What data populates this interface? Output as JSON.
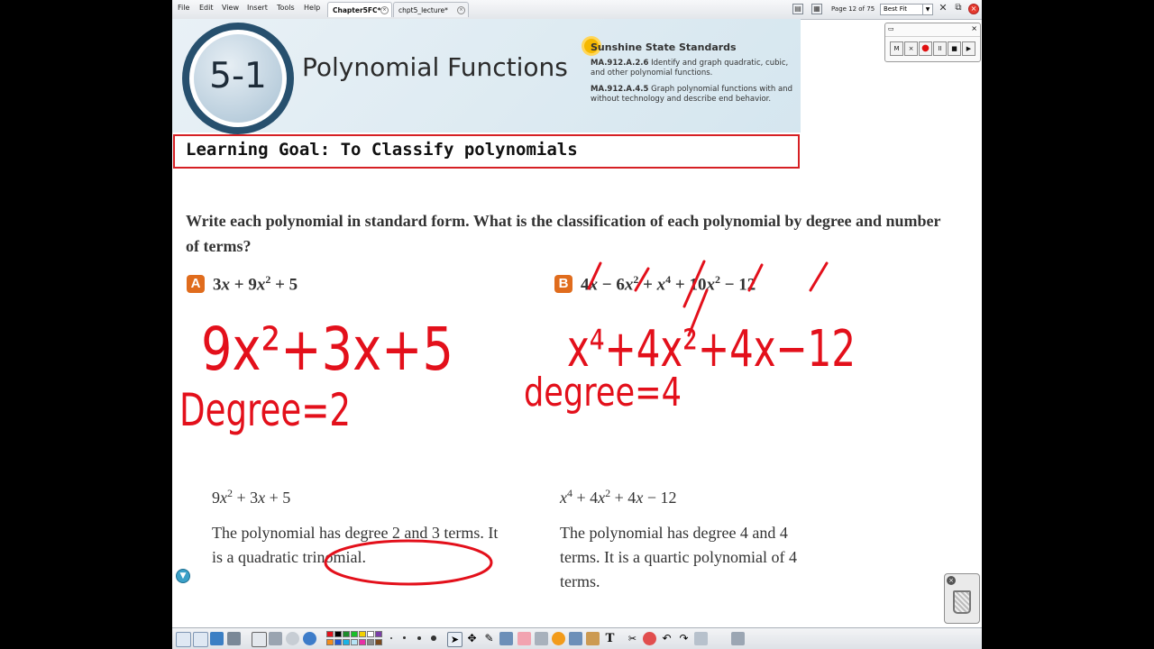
{
  "menu": [
    "File",
    "Edit",
    "View",
    "Insert",
    "Tools",
    "Help"
  ],
  "tabs": [
    {
      "label": "Chapter5FC*",
      "active": true
    },
    {
      "label": "chpt5_lecture*",
      "active": false
    }
  ],
  "toolbar": {
    "page_info": "Page 12 of 75",
    "zoom_value": "Best Fit"
  },
  "recorder": {
    "buttons": [
      "M",
      "×",
      "●",
      "II",
      "■",
      "▶"
    ]
  },
  "banner": {
    "lesson_number": "5-1",
    "lesson_title": "Polynomial Functions",
    "standards_title": "Sunshine State Standards",
    "standards": [
      {
        "code": "MA.912.A.2.6",
        "text": "Identify and graph quadratic, cubic, and other polynomial functions."
      },
      {
        "code": "MA.912.A.4.5",
        "text": "Graph polynomial functions with and without technology and describe end behavior."
      }
    ]
  },
  "learning_goal": "Learning Goal: To Classify polynomials",
  "question": "Write each polynomial in standard form. What is the classification of each polynomial by degree and number of terms?",
  "part_a": {
    "badge": "A",
    "solution_paragraph": "The polynomial has degree 2 and 3 terms. It is a quadratic trinomial."
  },
  "part_b": {
    "badge": "B",
    "solution_paragraph": "The polynomial has degree 4 and 4 terms. It is a quartic polynomial of 4 terms."
  },
  "handwriting": {
    "a_line1": "9x²+3x+5",
    "a_line2": "Degree=2",
    "b_line1": "x⁴+4x²+4x−12",
    "b_line2": "degree=4"
  },
  "colors": {
    "ink": "#e3101b",
    "goal_border": "#d62024",
    "badge": "#e06c1d",
    "tab_active": "#ffffff"
  },
  "icons": [
    "scroll-down-icon",
    "trash-icon",
    "select-arrow-icon",
    "pen-icon",
    "eraser-icon",
    "text-tool-icon",
    "undo-icon",
    "redo-icon"
  ]
}
